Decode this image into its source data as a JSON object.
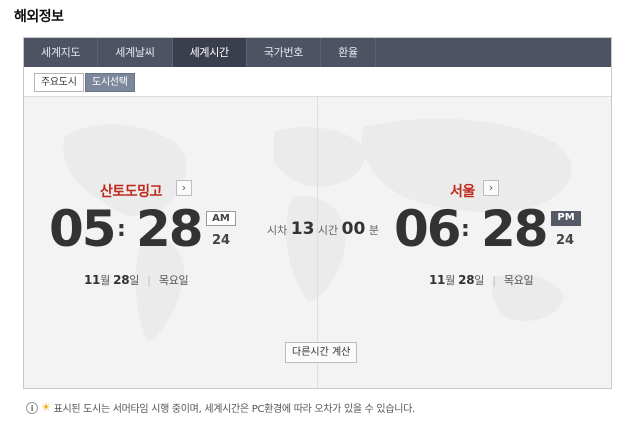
{
  "page_title": "해외정보",
  "tabs": [
    {
      "label": "세계지도"
    },
    {
      "label": "세계날씨"
    },
    {
      "label": "세계시간"
    },
    {
      "label": "국가번호"
    },
    {
      "label": "환율"
    }
  ],
  "active_tab": "세계시간",
  "subtabs": [
    {
      "label": "주요도시"
    },
    {
      "label": "도시선택"
    }
  ],
  "left_city": {
    "name": "산토도밍고",
    "hour": "05",
    "minute": "28",
    "ampm": "AM",
    "second": "24",
    "month": "11",
    "month_unit": "월",
    "day": "28",
    "day_unit": "일",
    "weekday": "목요일"
  },
  "right_city": {
    "name": "서울",
    "hour": "06",
    "minute": "28",
    "ampm": "PM",
    "second": "24",
    "month": "11",
    "month_unit": "월",
    "day": "28",
    "day_unit": "일",
    "weekday": "목요일"
  },
  "time_diff": {
    "label": "시차",
    "hours": "13",
    "hours_unit": "시간",
    "minutes": "00",
    "minutes_unit": "분"
  },
  "calc_button": "다른시간 계산",
  "notice": "표시된 도시는 서머타임 시행 중이며, 세계시간은 PC환경에 따라 오차가 있을 수 있습니다.",
  "icons": {
    "info": "info-icon",
    "sun": "sun-icon",
    "arrow": "chevron-right-icon"
  }
}
